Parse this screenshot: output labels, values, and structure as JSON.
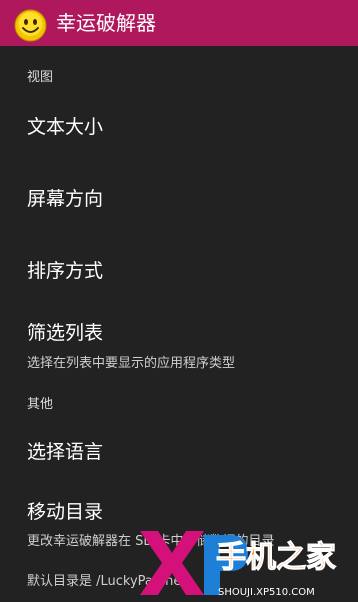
{
  "app": {
    "title": "幸运破解器",
    "icon": "smiley-icon"
  },
  "sections": {
    "view": "视图",
    "other": "其他"
  },
  "items": {
    "text_size": "文本大小",
    "screen_orientation": "屏幕方向",
    "sort_method": "排序方式",
    "filter_list": "筛选列表",
    "filter_list_summary": "选择在列表中要显示的应用程序类型",
    "select_language": "选择语言",
    "move_directory": "移动目录",
    "move_directory_summary_1": "更改幸运破解器在 SD 卡中存储数据的目录",
    "move_directory_summary_2": "默认目录是 /LuckyPatcher"
  },
  "watermark": {
    "logo": "XP",
    "brand": "手机之家",
    "site": "SHOUJI.XP510.COM"
  },
  "colors": {
    "appbar": "#b0185e",
    "background": "#222222",
    "watermark_orange": "#ff6a00",
    "watermark_magenta": "#d4117a"
  }
}
